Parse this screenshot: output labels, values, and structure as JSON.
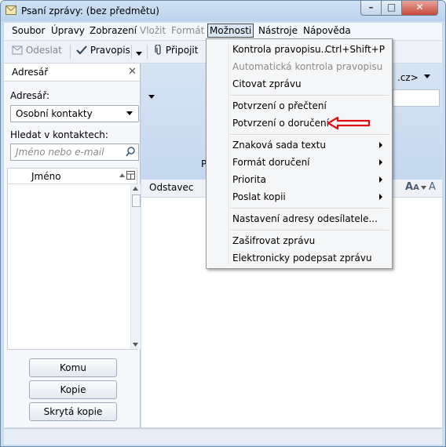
{
  "window": {
    "title": "Psaní zprávy: (bez předmětu)",
    "close_glyph": "✕",
    "min_glyph": "–",
    "max_glyph": "□"
  },
  "menubar": {
    "items": [
      {
        "label": "Soubor"
      },
      {
        "label": "Úpravy"
      },
      {
        "label": "Zobrazení"
      },
      {
        "label": "Vložit"
      },
      {
        "label": "Formát"
      },
      {
        "label": "Možnosti"
      },
      {
        "label": "Nástroje"
      },
      {
        "label": "Nápověda"
      }
    ]
  },
  "toolbar": {
    "send": "Odeslat",
    "spelling": "Pravopis",
    "attach": "Připojit"
  },
  "sidebar": {
    "title": "Adresář",
    "addressbook_label": "Adresář:",
    "addressbook_value": "Osobní kontakty",
    "search_label": "Hledat v kontaktech:",
    "search_placeholder": "Jméno nebo e-mail",
    "column_name": "Jméno",
    "buttons": {
      "to": "Komu",
      "cc": "Kopie",
      "bcc": "Skrytá kopie"
    }
  },
  "compose": {
    "from_fragment": ".cz>",
    "header_fragment": "P",
    "paragraph_format": "Odstavec"
  },
  "dropdown": {
    "items": [
      {
        "label": "Kontrola pravopisu...",
        "accel": "Ctrl+Shift+P"
      },
      {
        "label": "Automatická kontrola pravopisu",
        "disabled": true
      },
      {
        "label": "Citovat zprávu"
      },
      {
        "label": "Potvrzení o přečtení"
      },
      {
        "label": "Potvrzení o doručení"
      },
      {
        "label": "Znaková sada textu"
      },
      {
        "label": "Formát doručení"
      },
      {
        "label": "Priorita"
      },
      {
        "label": "Poslat kopii"
      },
      {
        "label": "Nastavení adresy odesílatele..."
      },
      {
        "label": "Zašifrovat zprávu"
      },
      {
        "label": "Elektronicky podepsat zprávu"
      }
    ]
  },
  "colors": {
    "annotation_arrow": "#e01010",
    "window_frame": "#c9dcf0",
    "menu_bg": "#f5f6f7"
  }
}
